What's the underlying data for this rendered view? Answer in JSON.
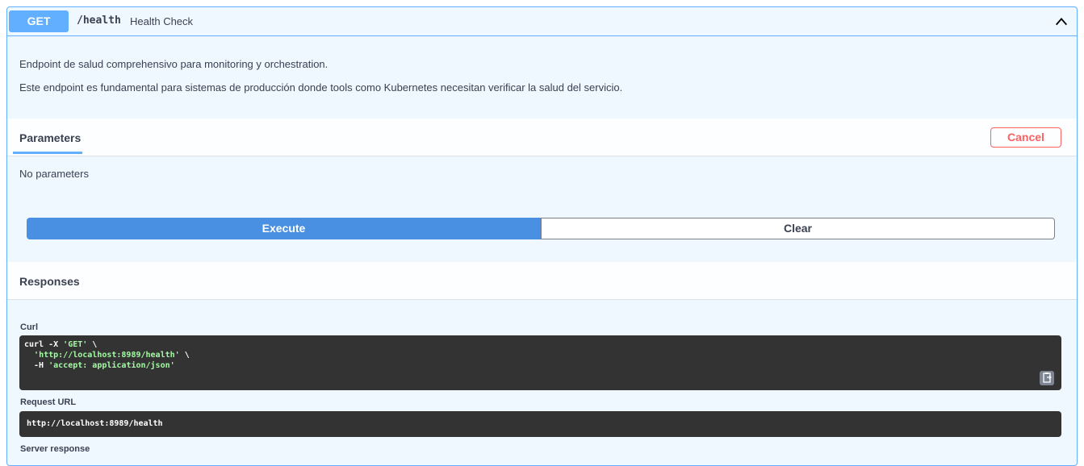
{
  "summary": {
    "method": "GET",
    "path": "/health",
    "description": "Health Check",
    "collapse_icon": "chevron-up-icon"
  },
  "description": {
    "line1": "Endpoint de salud comprehensivo para monitoring y orchestration.",
    "line2": "Este endpoint es fundamental para sistemas de producción donde tools como Kubernetes necesitan verificar la salud del servicio."
  },
  "parameters": {
    "tab_label": "Parameters",
    "cancel_label": "Cancel",
    "empty_text": "No parameters"
  },
  "actions": {
    "execute_label": "Execute",
    "clear_label": "Clear"
  },
  "responses": {
    "title": "Responses",
    "curl_label": "Curl",
    "curl": {
      "line1_cmd": "curl -X ",
      "line1_str": "'GET'",
      "line1_end": " \\",
      "line2_str": "'http://localhost:8989/health'",
      "line2_end": " \\",
      "line3_cmd": "  -H ",
      "line3_str": "'accept: application/json'"
    },
    "copy_icon": "clipboard-icon",
    "request_url_label": "Request URL",
    "request_url": "http://localhost:8989/health",
    "server_response_label": "Server response"
  },
  "colors": {
    "get_accent": "#61affe",
    "execute": "#4990e2",
    "cancel": "#ff6060",
    "code_bg": "#333333"
  }
}
